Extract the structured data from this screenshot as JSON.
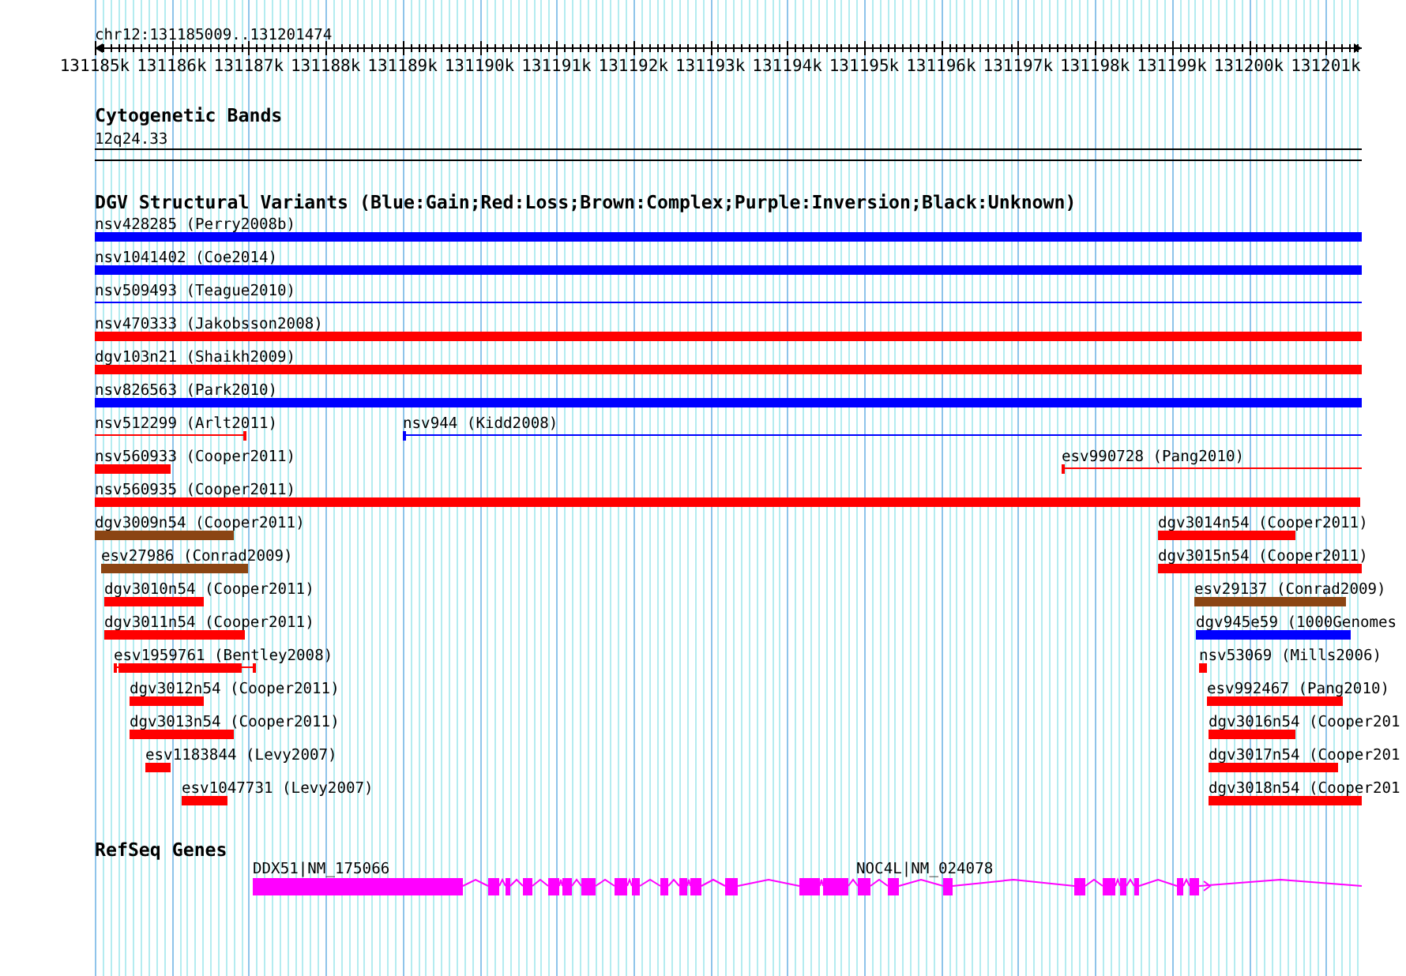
{
  "ruler": {
    "region": "chr12:131185009..131201474",
    "ticks": [
      "131185k",
      "131186k",
      "131187k",
      "131188k",
      "131189k",
      "131190k",
      "131191k",
      "131192k",
      "131193k",
      "131194k",
      "131195k",
      "131196k",
      "131197k",
      "131198k",
      "131199k",
      "131200k",
      "131201k"
    ]
  },
  "tracks": [
    {
      "kind": "cytoband",
      "title": "Cytogenetic Bands",
      "band": "12q24.33"
    },
    {
      "kind": "variants",
      "title": "DGV Structural Variants (Blue:Gain;Red:Loss;Brown:Complex;Purple:Inversion;Black:Unknown)",
      "rows": [
        {
          "features": [
            {
              "label": "nsv428285 (Perry2008b)",
              "color": "#0000ff",
              "kind": "bar"
            }
          ]
        },
        {
          "features": [
            {
              "label": "nsv1041402 (Coe2014)",
              "color": "#0000ff",
              "kind": "bar"
            }
          ]
        },
        {
          "features": [
            {
              "label": "nsv509493 (Teague2010)",
              "color": "#0000ff",
              "kind": "line"
            }
          ]
        },
        {
          "features": [
            {
              "label": "nsv470333 (Jakobsson2008)",
              "color": "#ff0000",
              "kind": "bar"
            }
          ]
        },
        {
          "features": [
            {
              "label": "dgv103n21 (Shaikh2009)",
              "color": "#ff0000",
              "kind": "bar"
            }
          ]
        },
        {
          "features": [
            {
              "label": "nsv826563 (Park2010)",
              "color": "#0000ff",
              "kind": "bar"
            }
          ]
        },
        {
          "features": [
            {
              "label": "nsv512299 (Arlt2011)",
              "color": "#ff0000",
              "kind": "capped"
            },
            {
              "label": "nsv944 (Kidd2008)",
              "color": "#0000ff",
              "kind": "capped"
            }
          ]
        },
        {
          "features": [
            {
              "label": "nsv560933 (Cooper2011)",
              "color": "#ff0000",
              "kind": "bar"
            },
            {
              "label": "esv990728 (Pang2010)",
              "color": "#ff0000",
              "kind": "capped"
            }
          ]
        },
        {
          "features": [
            {
              "label": "nsv560935 (Cooper2011)",
              "color": "#ff0000",
              "kind": "bar"
            }
          ]
        },
        {
          "features": [
            {
              "label": "dgv3009n54 (Cooper2011)",
              "color": "#8b4513",
              "kind": "bar"
            },
            {
              "label": "dgv3014n54 (Cooper2011)",
              "color": "#ff0000",
              "kind": "bar"
            }
          ]
        },
        {
          "features": [
            {
              "label": "esv27986 (Conrad2009)",
              "color": "#8b4513",
              "kind": "bar"
            },
            {
              "label": "dgv3015n54 (Cooper2011)",
              "color": "#ff0000",
              "kind": "bar"
            }
          ]
        },
        {
          "features": [
            {
              "label": "dgv3010n54 (Cooper2011)",
              "color": "#ff0000",
              "kind": "bar"
            },
            {
              "label": "esv29137 (Conrad2009)",
              "color": "#8b4513",
              "kind": "bar"
            }
          ]
        },
        {
          "features": [
            {
              "label": "dgv3011n54 (Cooper2011)",
              "color": "#ff0000",
              "kind": "bar"
            },
            {
              "label": "dgv945e59 (1000Genomes",
              "color": "#0000ff",
              "kind": "bar"
            }
          ]
        },
        {
          "features": [
            {
              "label": "esv1959761 (Bentley2008)",
              "color": "#ff0000",
              "kind": "whisker"
            },
            {
              "label": "nsv53069 (Mills2006)",
              "color": "#ff0000",
              "kind": "bar"
            }
          ]
        },
        {
          "features": [
            {
              "label": "dgv3012n54 (Cooper2011)",
              "color": "#ff0000",
              "kind": "bar"
            },
            {
              "label": "esv992467 (Pang2010)",
              "color": "#ff0000",
              "kind": "bar"
            }
          ]
        },
        {
          "features": [
            {
              "label": "dgv3013n54 (Cooper2011)",
              "color": "#ff0000",
              "kind": "bar"
            },
            {
              "label": "dgv3016n54 (Cooper201",
              "color": "#ff0000",
              "kind": "bar"
            }
          ]
        },
        {
          "features": [
            {
              "label": "esv1183844 (Levy2007)",
              "color": "#ff0000",
              "kind": "bar"
            },
            {
              "label": "dgv3017n54 (Cooper201",
              "color": "#ff0000",
              "kind": "bar"
            }
          ]
        },
        {
          "features": [
            {
              "label": "esv1047731 (Levy2007)",
              "color": "#ff0000",
              "kind": "bar"
            },
            {
              "label": "dgv3018n54 (Cooper201",
              "color": "#ff0000",
              "kind": "bar"
            }
          ]
        }
      ]
    },
    {
      "kind": "genes",
      "title": "RefSeq Genes",
      "genes": [
        {
          "label": "DDX51|NM_175066"
        },
        {
          "label": "NOC4L|NM_024078"
        }
      ]
    }
  ]
}
